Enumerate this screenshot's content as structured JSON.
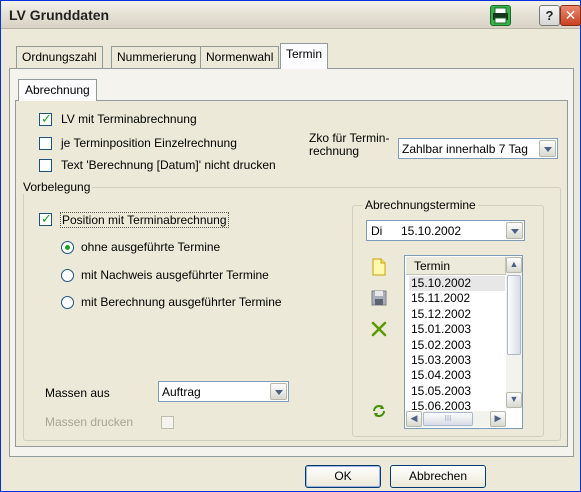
{
  "window": {
    "title": "LV Grunddaten"
  },
  "tabs": [
    {
      "label": "Ordnungszahl"
    },
    {
      "label": "Nummerierung"
    },
    {
      "label": "Normenwahl"
    },
    {
      "label": "Termin"
    }
  ],
  "subtab": {
    "label": "Abrechnung"
  },
  "options": {
    "lv_terminabrechnung": {
      "label": "LV mit Terminabrechnung",
      "checked": true
    },
    "einzelrechnung": {
      "label": "je Terminposition Einzelrechnung",
      "checked": false
    },
    "text_nicht_drucken": {
      "label": "Text 'Berechnung [Datum]' nicht drucken",
      "checked": false
    }
  },
  "zko": {
    "label_line1": "Zko für Termin-",
    "label_line2": "rechnung",
    "value": "Zahlbar innerhalb 7 Tag"
  },
  "vorbelegung": {
    "title": "Vorbelegung",
    "position_checkbox": {
      "label": "Position mit Terminabrechnung",
      "checked": true
    },
    "radios": [
      {
        "label": "ohne ausgeführte Termine",
        "checked": true
      },
      {
        "label": "mit Nachweis ausgeführter Termine",
        "checked": false
      },
      {
        "label": "mit Berechnung ausgeführter Termine",
        "checked": false
      }
    ],
    "massen_aus": {
      "label": "Massen aus",
      "value": "Auftrag"
    },
    "massen_drucken": {
      "label": "Massen drucken",
      "checked": false
    }
  },
  "abrechnungstermine": {
    "title": "Abrechnungstermine",
    "date_combo": {
      "weekday": "Di",
      "date": "15.10.2002"
    },
    "column_header": "Termin",
    "rows": [
      "15.10.2002",
      "15.11.2002",
      "15.12.2002",
      "15.01.2003",
      "15.02.2003",
      "15.03.2003",
      "15.04.2003",
      "15.05.2003",
      "15.06.2003"
    ],
    "selected_index": 0
  },
  "buttons": {
    "ok": "OK",
    "cancel": "Abbrechen"
  },
  "colors": {
    "window_bg": "#ece9d8",
    "checkmark": "#21a121",
    "title_border": "#0831d9"
  }
}
